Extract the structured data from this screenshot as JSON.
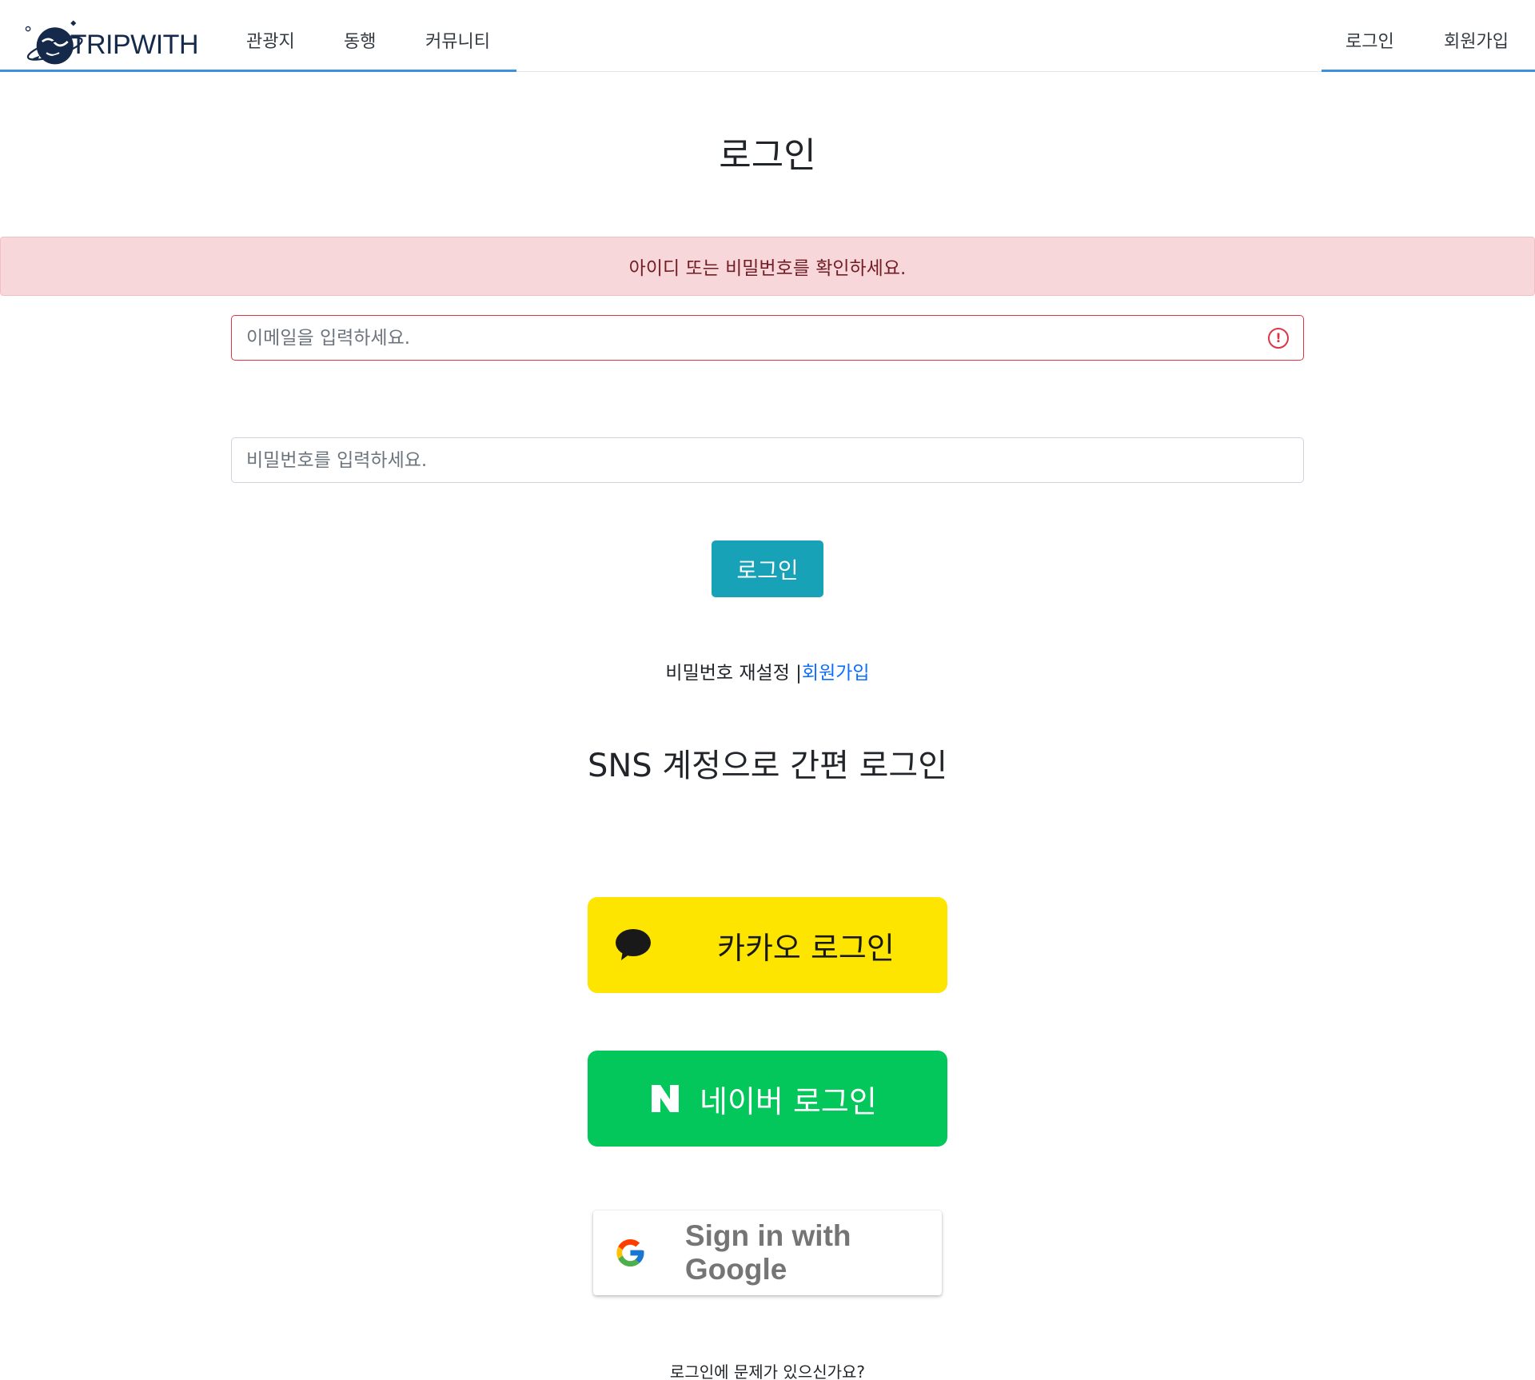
{
  "nav": {
    "brand": "TRIPWITH",
    "links": [
      "관광지",
      "동행",
      "커뮤니티"
    ],
    "auth": [
      "로그인",
      "회원가입"
    ]
  },
  "page": {
    "title": "로그인",
    "alert": "아이디 또는 비밀번호를 확인하세요."
  },
  "form": {
    "email_placeholder": "이메일을 입력하세요.",
    "password_placeholder": "비밀번호를 입력하세요.",
    "submit_label": "로그인"
  },
  "links": {
    "reset_password": "비밀번호 재설정",
    "separator": "|",
    "signup": "회원가입"
  },
  "sns": {
    "title": "SNS 계정으로 간편 로그인",
    "kakao_label": "카카오 로그인",
    "naver_label": "네이버 로그인",
    "google_label": "Sign in with Google"
  },
  "help": "로그인에 문제가 있으신가요?",
  "colors": {
    "accent_line": "#3d8fe0",
    "alert_bg": "#f8d7da",
    "alert_text": "#721c24",
    "login_button": "#17a2b8",
    "kakao": "#fee500",
    "naver": "#03c75a",
    "link": "#0d6efd"
  }
}
